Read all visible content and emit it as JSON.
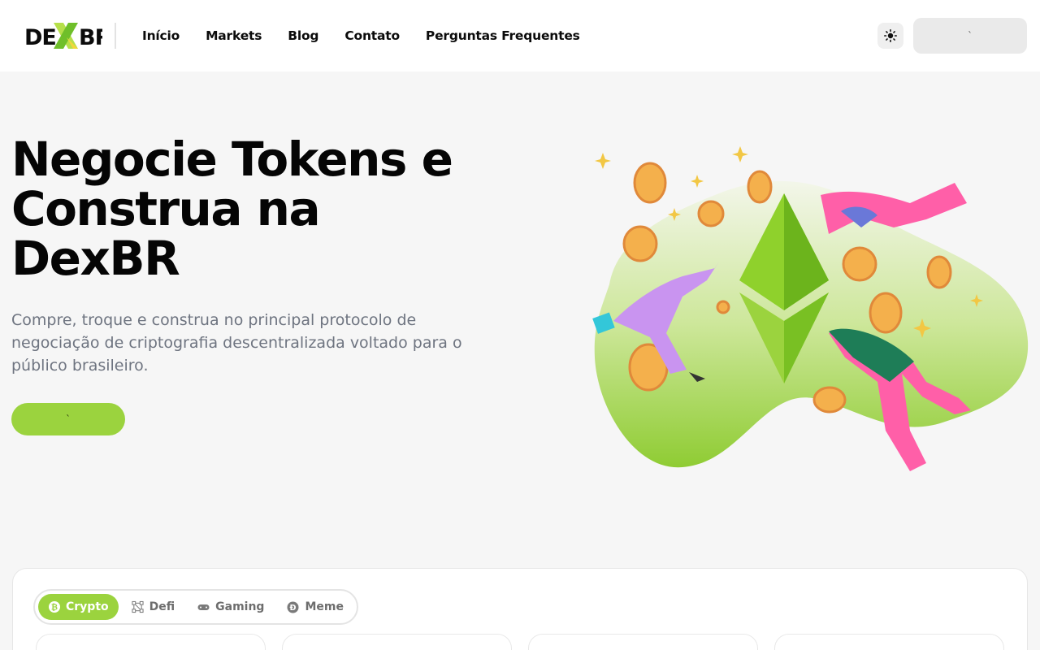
{
  "brand": {
    "logo_prefix": "DE",
    "logo_x": "X",
    "logo_suffix": "BR",
    "accent_color": "#9bd33e"
  },
  "nav": {
    "items": [
      {
        "label": "Início"
      },
      {
        "label": "Markets"
      },
      {
        "label": "Blog"
      },
      {
        "label": "Contato"
      },
      {
        "label": "Perguntas Frequentes"
      }
    ]
  },
  "header": {
    "theme_icon": "sun-icon",
    "connect_label": "`"
  },
  "hero": {
    "title": "Negocie Tokens e Construa na DexBR",
    "subtitle": "Compre, troque e construa no principal protocolo de negociação de criptografia descentralizada voltado para o público brasileiro.",
    "cta_label": "`",
    "illustration": "ethereum-coins-illustration"
  },
  "markets": {
    "tabs": [
      {
        "label": "Crypto",
        "icon": "bitcoin-icon",
        "active": true
      },
      {
        "label": "Defi",
        "icon": "network-icon",
        "active": false
      },
      {
        "label": "Gaming",
        "icon": "gamepad-icon",
        "active": false
      },
      {
        "label": "Meme",
        "icon": "dogecoin-icon",
        "active": false
      }
    ]
  }
}
